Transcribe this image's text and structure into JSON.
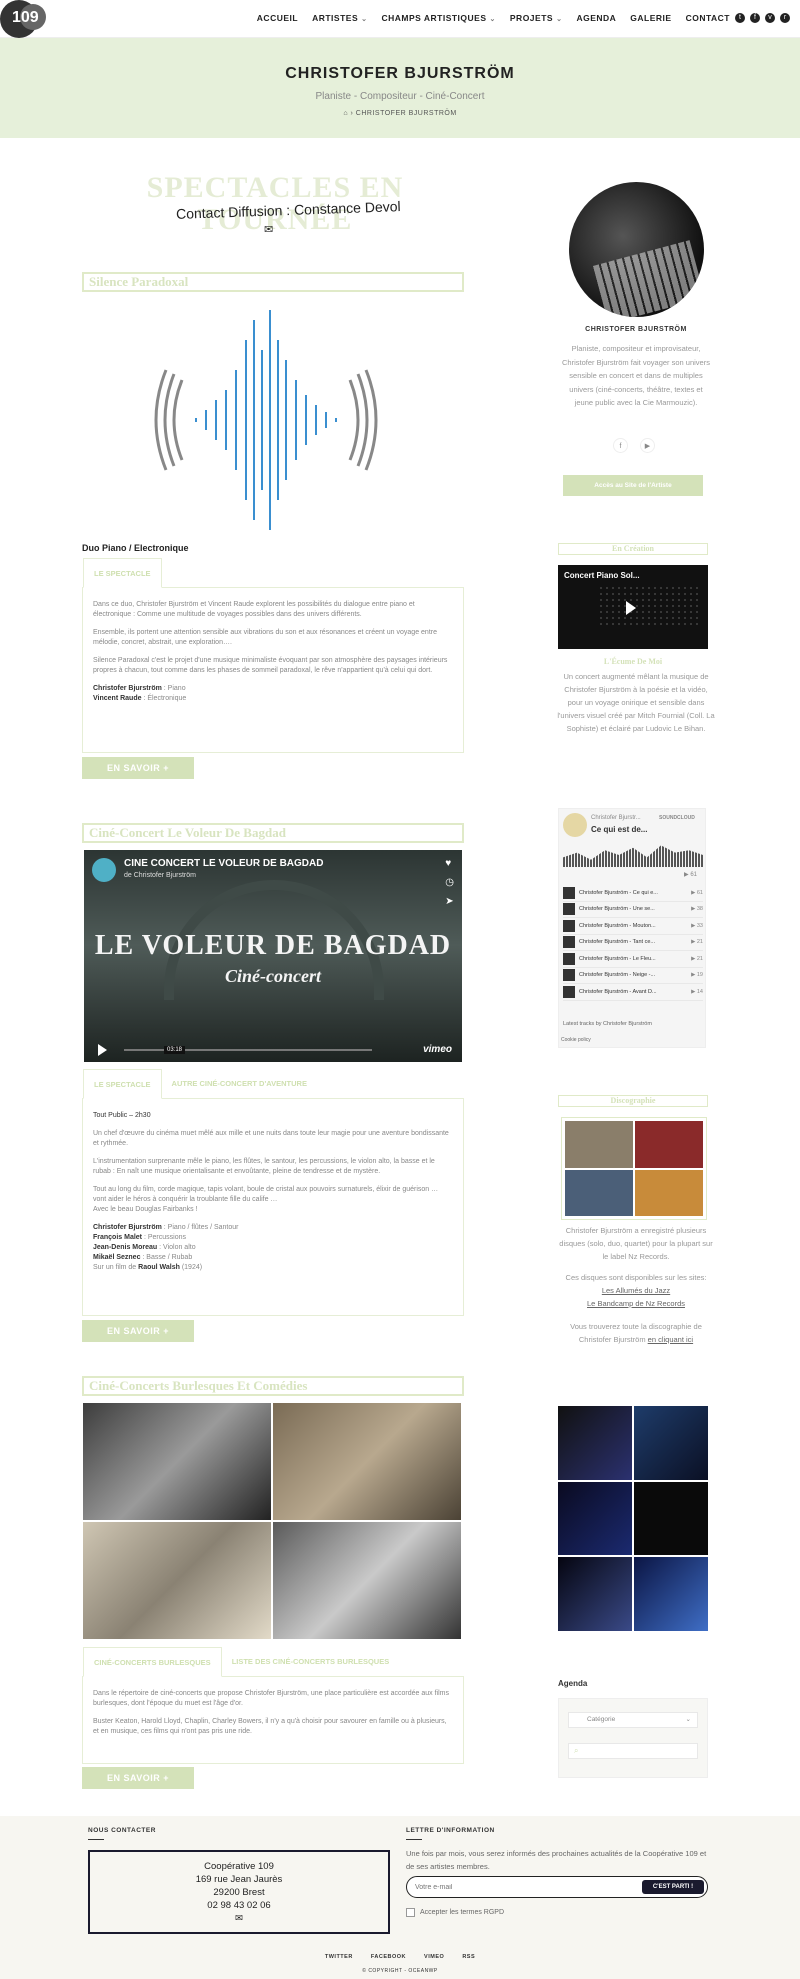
{
  "header": {
    "logo_text": "109",
    "nav": [
      {
        "label": "ACCUEIL",
        "chevron": false
      },
      {
        "label": "ARTISTES",
        "chevron": true
      },
      {
        "label": "CHAMPS ARTISTIQUES",
        "chevron": true
      },
      {
        "label": "PROJETS",
        "chevron": true
      },
      {
        "label": "AGENDA",
        "chevron": false
      },
      {
        "label": "GALERIE",
        "chevron": false
      },
      {
        "label": "CONTACT",
        "chevron": false
      }
    ],
    "social_icons": [
      "twitter-icon",
      "facebook-icon",
      "vimeo-icon",
      "rss-icon"
    ]
  },
  "hero": {
    "title": "CHRISTOFER BJURSTRÖM",
    "subtitle": "Planiste - Compositeur - Ciné-Concert",
    "breadcrumb": "CHRISTOFER BJURSTRÖM"
  },
  "banner": {
    "heading": "SPECTACLES EN TOURNÉE",
    "contact": "Contact Diffusion : Constance Devol"
  },
  "silence": {
    "title": "Silence Paradoxal",
    "label": "Duo Piano / Electronique",
    "tab": "LE SPECTACLE",
    "p1": "Dans ce duo, Christofer Bjurström et Vincent Raude explorent les possibilités du dialogue entre piano et électronique : Comme une multitude de voyages possibles dans des univers différents.",
    "p2": "Ensemble, ils portent une attention sensible aux vibrations du son et aux résonances et créent un voyage entre mélodie, concret, abstrait, une exploration….",
    "p3": "Silence Paradoxal c'est le projet d'une musique minimaliste évoquant par son atmosphère des paysages intérieurs propres à chacun, tout comme dans les phases de sommeil paradoxal, le rêve n'appartient qu'à celui qui dort.",
    "credit1_name": "Christofer Bjurström",
    "credit1_role": " : Piano",
    "credit2_name": "Vincent Raude",
    "credit2_role": " : Électronique",
    "button": "EN SAVOIR +"
  },
  "bagdad": {
    "title": "Ciné-Concert Le Voleur De Bagdad",
    "video_title": "CINE CONCERT LE VOLEUR DE BAGDAD",
    "video_by": "de Christofer Bjurström",
    "video_big": "LE VOLEUR DE BAGDAD",
    "video_sub": "Ciné-concert",
    "video_time": "03:18",
    "video_brand": "vimeo",
    "tab1": "LE SPECTACLE",
    "tab2": "AUTRE CINÉ-CONCERT D'AVENTURE",
    "audience": "Tout Public – 2h30",
    "p1": "Un chef d'œuvre du cinéma muet mêlé aux mille et une nuits dans toute leur magie pour une aventure bondissante et rythmée.",
    "p2": "L'instrumentation surprenante mêle le piano, les flûtes, le santour, les percussions, le violon alto, la basse et le rubab : En naît une musique orientalisante et envoûtante, pleine de tendresse et de mystère.",
    "p3": "Tout au long du film, corde magique, tapis volant, boule de cristal aux pouvoirs surnaturels, élixir de guérison … vont aider le héros à conquérir la troublante fille du calife …",
    "p4": "Avec le beau Douglas Fairbanks !",
    "credits": [
      {
        "name": "Christofer Bjurström",
        "role": " : Piano / flûtes / Santour"
      },
      {
        "name": "François Malet",
        "role": " : Percussions"
      },
      {
        "name": "Jean-Denis Moreau",
        "role": " : Violon alto"
      },
      {
        "name": "Mikaël Seznec",
        "role": " : Basse / Rubab"
      }
    ],
    "film_prefix": "Sur un film de ",
    "film_name": "Raoul Walsh",
    "film_year": " (1924)",
    "button": "EN SAVOIR +"
  },
  "burlesque": {
    "title": "Ciné-Concerts Burlesques Et Comédies",
    "tab1": "CINÉ-CONCERTS BURLESQUES",
    "tab2": "LISTE DES CINÉ-CONCERTS BURLESQUES",
    "p1": "Dans le répertoire de ciné-concerts que propose Christofer Bjurström, une place particulière est accordée aux films burlesques, dont l'époque du muet est l'âge d'or.",
    "p2": "Buster Keaton, Harold Lloyd, Chaplin, Charley Bowers, il n'y a qu'à choisir pour savourer en famille ou à plusieurs, et en musique, ces films qui n'ont pas pris une ride.",
    "button": "EN SAVOIR +"
  },
  "sidebar": {
    "name": "CHRISTOFER BJURSTRÖM",
    "bio": "Planiste, compositeur et improvisateur, Christofer Bjurström fait voyager son univers sensible en concert et dans de multiples univers (ciné-concerts, théâtre, textes et jeune public avec la Cie Marmouzic).",
    "button": "Accès au Site de l'Artiste",
    "creation_title": "En Création",
    "creation_video": "Concert Piano Sol...",
    "creation_sub": "L'Écume De Moi",
    "creation_text": "Un concert augmenté mêlant la musique de Christofer Bjurström à la poésie et la vidéo, pour un voyage onirique et sensible dans l'univers visuel créé par Mitch Fournial (Coll. La Sophiste) et éclairé par Ludovic Le Bihan.",
    "soundcloud": {
      "artist": "Christofer Bjurstr...",
      "track": "Ce qui est de...",
      "brand": "SOUNDCLOUD",
      "plays": "▶ 61",
      "tracks": [
        {
          "name": "Christofer Bjurström - Ce qui e...",
          "plays": "▶ 61"
        },
        {
          "name": "Christofer Bjurström - Une se...",
          "plays": "▶ 38"
        },
        {
          "name": "Christofer Bjurström - Mouton...",
          "plays": "▶ 33"
        },
        {
          "name": "Christofer Bjurström - Tant ce...",
          "plays": "▶ 21"
        },
        {
          "name": "Christofer Bjurström - Le Fleu...",
          "plays": "▶ 21"
        },
        {
          "name": "Christofer Bjurström - Neige -...",
          "plays": "▶ 19"
        },
        {
          "name": "Christofer Bjurström - Avant D...",
          "plays": "▶ 14"
        }
      ],
      "footer": "Latest tracks by Christofer Bjurström",
      "cookie": "Cookie policy"
    },
    "disco_title": "Discographie",
    "disco_text1": "Christofer Bjurström a enregistré plusieurs disques (solo, duo, quartet) pour la plupart sur le label Nz Records.",
    "disco_text2": "Ces disques sont disponibles sur les sites:",
    "disco_link1": "Les Allumés du Jazz",
    "disco_link2": "Le Bandcamp de Nz Records",
    "disco_text3": "Vous trouverez toute la discographie de Christofer Bjurström ",
    "disco_link3": "en cliquant ici",
    "agenda": "Agenda",
    "agenda_select": "Catégorie"
  },
  "footer": {
    "contact_h": "NOUS CONTACTER",
    "addr": [
      "Coopérative 109",
      "169 rue Jean Jaurès",
      "29200 Brest",
      "02 98 43 02 06"
    ],
    "news_h": "LETTRE D'INFORMATION",
    "news_text": "Une fois par mois, vous serez informés des prochaines actualités de la Coopérative 109 et de ses artistes membres.",
    "email_placeholder": "Votre e-mail",
    "news_button": "C'EST PARTI !",
    "rgpd": "Accepter les termes RGPD",
    "links": [
      "TWITTER",
      "FACEBOOK",
      "VIMEO",
      "RSS"
    ],
    "copyright": "© COPYRIGHT - OCEANWP"
  }
}
